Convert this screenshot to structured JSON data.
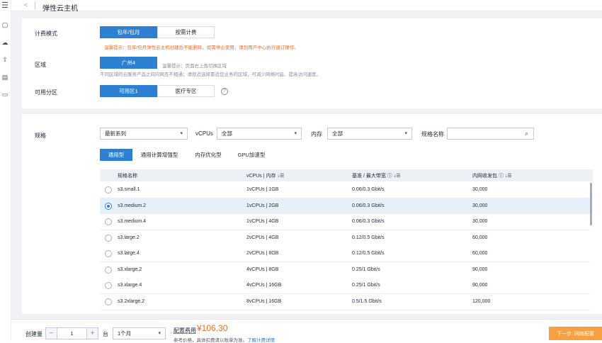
{
  "header": {
    "back": "<",
    "title": "弹性云主机"
  },
  "sidebar": {
    "icons": [
      "menu-icon",
      "server-icon",
      "cloud-icon",
      "upload-icon",
      "document-icon",
      "monitor-icon"
    ]
  },
  "billing": {
    "label": "计费模式",
    "options": [
      "包年/包月",
      "按需计费"
    ],
    "selected": "包年/包月",
    "tip": "温馨提示：包年/包月弹性云主机创建后不能删除，如需停止使用，请到用户中心执行退订操作。"
  },
  "region": {
    "label": "区域",
    "value": "广州4",
    "tip1": "温馨提示：页面右上角切换区域",
    "tip2": "不同区域的云服务产品之间内网互不相通；请就近选择靠近您业务的区域，可减少网络时延、提高访问速度。"
  },
  "az": {
    "label": "可用分区",
    "options": [
      "可用区1",
      "医疗专区"
    ],
    "selected": "可用区1",
    "help": "?"
  },
  "spec": {
    "label": "规格",
    "series": "最新系列",
    "vcpu_label": "vCPUs",
    "vcpu_value": "全部",
    "mem_label": "内存",
    "mem_value": "全部",
    "name_label": "规格名称",
    "search_placeholder": "",
    "tabs": [
      "通用型",
      "通用计算增强型",
      "内存优化型",
      "GPU加速型"
    ],
    "active_tab": "通用型"
  },
  "table": {
    "headers": [
      "规格名称",
      "vCPUs | 内存",
      "基准 / 最大带宽",
      "内网收发包"
    ],
    "rows": [
      {
        "name": "s3.small.1",
        "vcpu": "1vCPUs | 1GB",
        "bw": "0.06/0.3 Gbit/s",
        "pps": "30,000",
        "selected": false
      },
      {
        "name": "s3.medium.2",
        "vcpu": "1vCPUs | 2GB",
        "bw": "0.06/0.3 Gbit/s",
        "pps": "30,000",
        "selected": true
      },
      {
        "name": "s3.medium.4",
        "vcpu": "1vCPUs | 4GB",
        "bw": "0.06/0.3 Gbit/s",
        "pps": "30,000",
        "selected": false
      },
      {
        "name": "s3.large.2",
        "vcpu": "2vCPUs | 4GB",
        "bw": "0.12/0.5 Gbit/s",
        "pps": "60,000",
        "selected": false
      },
      {
        "name": "s3.large.4",
        "vcpu": "2vCPUs | 8GB",
        "bw": "0.12/0.5 Gbit/s",
        "pps": "60,000",
        "selected": false
      },
      {
        "name": "s3.xlarge.2",
        "vcpu": "4vCPUs | 8GB",
        "bw": "0.25/1 Gbit/s",
        "pps": "90,000",
        "selected": false
      },
      {
        "name": "s3.xlarge.4",
        "vcpu": "4vCPUs | 16GB",
        "bw": "0.25/1 Gbit/s",
        "pps": "90,000",
        "selected": false
      },
      {
        "name": "s3.2xlarge.2",
        "vcpu": "8vCPUs | 16GB",
        "bw": "0.5/1.5 Gbit/s",
        "pps": "120,000",
        "selected": false
      }
    ]
  },
  "footer": {
    "qty_label": "创建量",
    "qty": "1",
    "unit": "台",
    "duration": "1个月",
    "fee_label": "配置费用",
    "price": "¥106.30",
    "note": "参考价格，具体扣费请以账单为准。",
    "link": "了解计费详情",
    "next": "下一步: 网络配置"
  },
  "colors": {
    "primary": "#2d7fd2",
    "accent": "#f26c20",
    "next": "#f6a042"
  }
}
